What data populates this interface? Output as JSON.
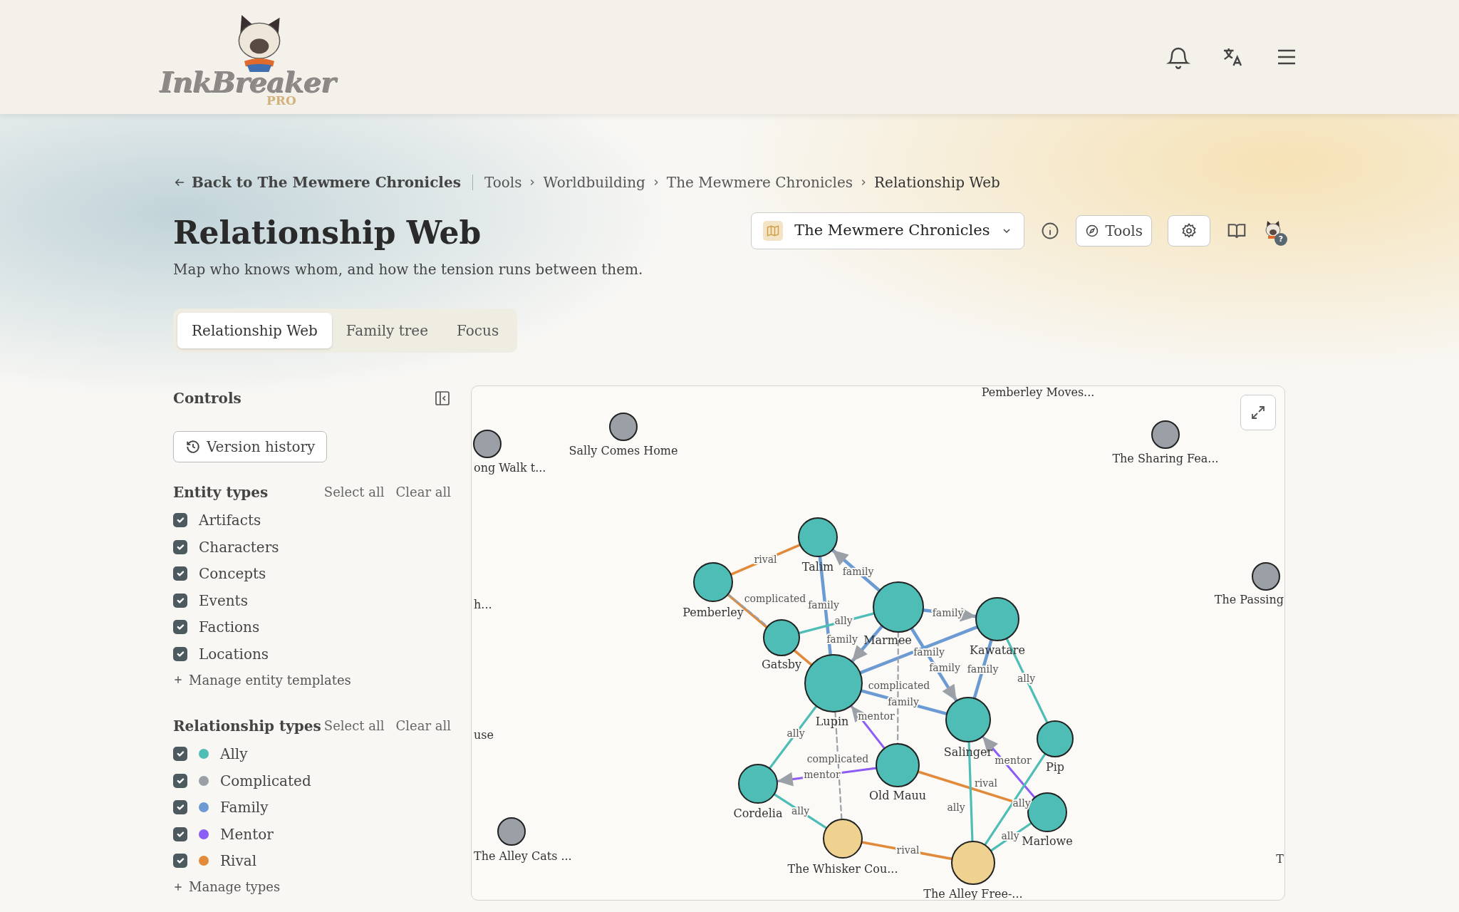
{
  "header": {
    "logo": {
      "name": "InkBreaker",
      "badge": "PRO"
    }
  },
  "breadcrumb": {
    "back": "Back to The Mewmere Chronicles",
    "items": [
      "Tools",
      "Worldbuilding",
      "The Mewmere Chronicles",
      "Relationship Web"
    ]
  },
  "page": {
    "title": "Relationship Web",
    "subtitle": "Map who knows whom, and how the tension runs between them."
  },
  "toolbar": {
    "project": "The Mewmere Chronicles",
    "tools_button": "Tools",
    "help_badge": "?"
  },
  "tabs": [
    {
      "label": "Relationship Web",
      "selected": true
    },
    {
      "label": "Family tree",
      "selected": false
    },
    {
      "label": "Focus",
      "selected": false
    }
  ],
  "controls": {
    "title": "Controls",
    "version_history": "Version history",
    "entity_types": {
      "title": "Entity types",
      "select_all": "Select all",
      "clear_all": "Clear all",
      "manage": "Manage entity templates",
      "items": [
        {
          "label": "Artifacts",
          "checked": true
        },
        {
          "label": "Characters",
          "checked": true
        },
        {
          "label": "Concepts",
          "checked": true
        },
        {
          "label": "Events",
          "checked": true
        },
        {
          "label": "Factions",
          "checked": true
        },
        {
          "label": "Locations",
          "checked": true
        }
      ]
    },
    "relationship_types": {
      "title": "Relationship types",
      "select_all": "Select all",
      "clear_all": "Clear all",
      "manage": "Manage types",
      "items": [
        {
          "kind": "ally",
          "label": "Ally",
          "color": "#4dbdb5",
          "checked": true
        },
        {
          "kind": "complicated",
          "label": "Complicated",
          "color": "#9aa0a6",
          "checked": true
        },
        {
          "kind": "family",
          "label": "Family",
          "color": "#6b9bd2",
          "checked": true
        },
        {
          "kind": "mentor",
          "label": "Mentor",
          "color": "#8b5cf6",
          "checked": true
        },
        {
          "kind": "rival",
          "label": "Rival",
          "color": "#e08a3a",
          "checked": true
        }
      ]
    }
  },
  "graph": {
    "nodes": [
      {
        "label": "Pemberley Moves..."
      },
      {
        "label": "ong Walk t...",
        "kind": "event"
      },
      {
        "label": "Sally Comes Home",
        "kind": "event"
      },
      {
        "label": "The Sharing Fea...",
        "kind": "event"
      },
      {
        "label": "Talim",
        "kind": "character"
      },
      {
        "label": "Pemberley",
        "kind": "character"
      },
      {
        "label": "h..."
      },
      {
        "label": "Marmee",
        "kind": "character"
      },
      {
        "label": "Kawatare",
        "kind": "character"
      },
      {
        "label": "The Passing",
        "kind": "event"
      },
      {
        "label": "Gatsby",
        "kind": "character"
      },
      {
        "label": "Lupin",
        "kind": "character"
      },
      {
        "label": "use"
      },
      {
        "label": "Salinger",
        "kind": "character"
      },
      {
        "label": "Pip",
        "kind": "character"
      },
      {
        "label": "Old Mauu",
        "kind": "character"
      },
      {
        "label": "Cordelia",
        "kind": "character"
      },
      {
        "label": "Marlowe",
        "kind": "character"
      },
      {
        "label": "The Alley Cats ...",
        "kind": "event"
      },
      {
        "label": "The Whisker Cou...",
        "kind": "location"
      },
      {
        "label": "T"
      },
      {
        "label": "The Alley Free-...",
        "kind": "location"
      }
    ],
    "edges": [
      {
        "kind": "rival",
        "label": "rival",
        "directed": false
      },
      {
        "kind": "rival",
        "directed": false
      },
      {
        "kind": "complicated",
        "label": "complicated",
        "directed": false
      },
      {
        "kind": "family",
        "label": "family",
        "directed": false
      },
      {
        "kind": "family",
        "label": "family",
        "directed": true
      },
      {
        "kind": "ally",
        "label": "ally",
        "directed": false
      },
      {
        "kind": "family",
        "label": "family",
        "directed": true
      },
      {
        "kind": "family",
        "label": "family",
        "directed": true
      },
      {
        "kind": "family",
        "label": "family",
        "directed": true
      },
      {
        "kind": "family",
        "label": "family",
        "directed": false
      },
      {
        "kind": "family",
        "label": "family",
        "directed": false
      },
      {
        "kind": "ally",
        "label": "ally",
        "directed": false
      },
      {
        "kind": "complicated",
        "label": "complicated",
        "directed": false
      },
      {
        "kind": "family",
        "label": "family",
        "directed": false
      },
      {
        "kind": "ally",
        "label": "ally",
        "directed": false
      },
      {
        "kind": "mentor",
        "label": "mentor",
        "directed": true
      },
      {
        "kind": "complicated",
        "label": "complicated",
        "directed": false
      },
      {
        "kind": "mentor",
        "label": "mentor",
        "directed": true
      },
      {
        "kind": "ally",
        "label": "ally",
        "directed": false
      },
      {
        "kind": "rival",
        "label": "rival",
        "directed": false
      },
      {
        "kind": "ally",
        "label": "ally",
        "directed": false
      },
      {
        "kind": "mentor",
        "label": "mentor",
        "directed": true
      },
      {
        "kind": "ally",
        "label": "ally",
        "directed": false
      },
      {
        "kind": "ally",
        "label": "ally",
        "directed": false
      },
      {
        "kind": "rival",
        "label": "rival",
        "directed": false
      }
    ]
  }
}
